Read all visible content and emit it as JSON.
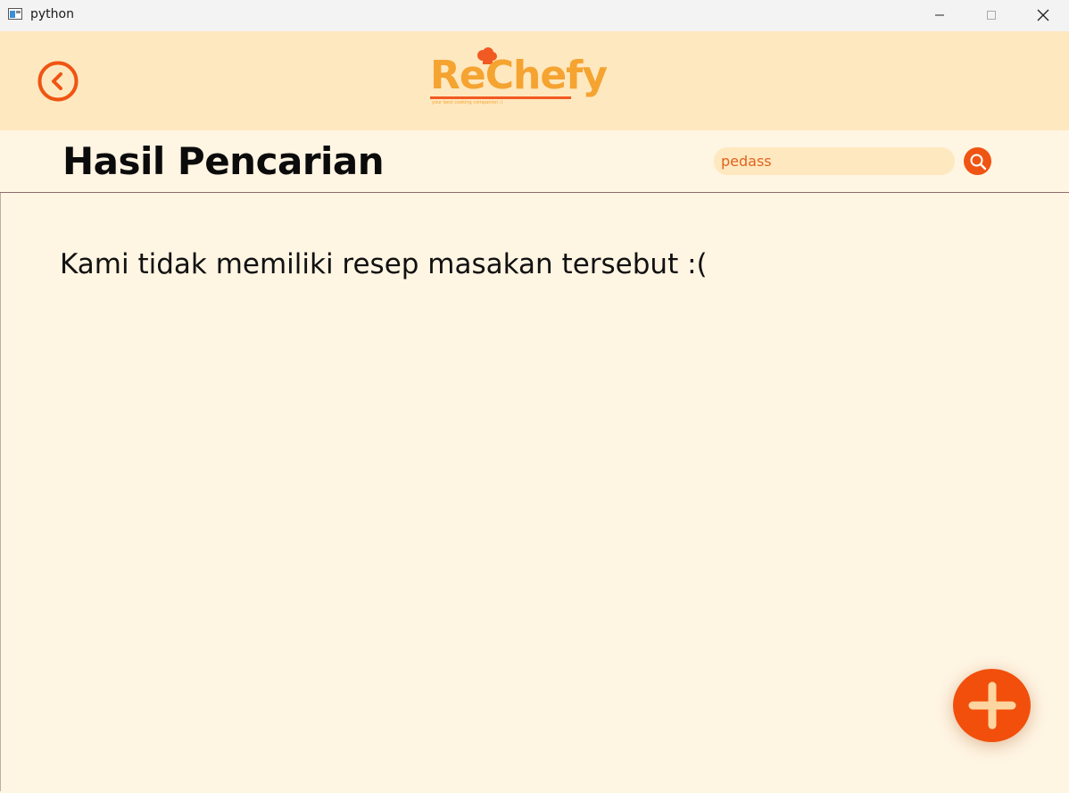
{
  "window": {
    "title": "python",
    "minimize_label": "minimize",
    "maximize_label": "maximize",
    "close_label": "close"
  },
  "header": {
    "logo_text": "ReChefy",
    "logo_tagline": "your best cooking companion :)",
    "back_icon": "chevron-left-circle-icon",
    "brand_colors": {
      "orange": "#f5a331",
      "red_orange": "#f15a22"
    }
  },
  "search": {
    "page_title": "Hasil Pencarian",
    "query_value": "pedass",
    "button_icon": "search-icon"
  },
  "results": {
    "empty_message": "Kami tidak memiliki resep masakan tersebut :("
  },
  "fab": {
    "icon": "plus-icon",
    "color": "#f24f0c"
  }
}
